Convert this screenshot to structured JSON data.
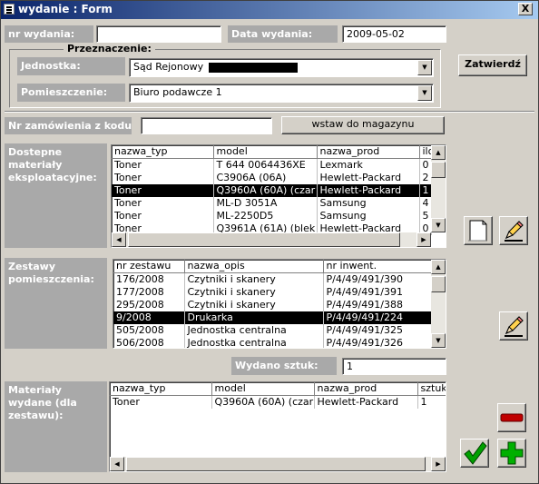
{
  "window": {
    "title": "wydanie : Form",
    "close_label": "X"
  },
  "header": {
    "nr_wydania_label": "nr wydania:",
    "nr_wydania_value": "",
    "data_wydania_label": "Data wydania:",
    "data_wydania_value": "2009-05-02"
  },
  "przeznaczenie": {
    "legend": "Przeznaczenie:",
    "jednostka_label": "Jednostka:",
    "jednostka_value": "Sąd Rejonowy",
    "pomieszczenie_label": "Pomieszczenie:",
    "pomieszczenie_value": "Biuro podawcze 1",
    "confirm_label": "Zatwierdź"
  },
  "order": {
    "label": "Nr zamówienia z kodu:",
    "value": "",
    "insert_label": "wstaw do magazynu"
  },
  "materials": {
    "label": "Dostepne materiały eksploatacyjne:",
    "columns": [
      "nazwa_typ",
      "model",
      "nazwa_prod",
      "ilo"
    ],
    "rows": [
      [
        "Toner",
        "T 644 0064436XE",
        "Lexmark",
        "0"
      ],
      [
        "Toner",
        "C3906A (06A)",
        "Hewlett-Packard",
        "2"
      ],
      [
        "Toner",
        "Q3960A (60A) (czar",
        "Hewlett-Packard",
        "1"
      ],
      [
        "Toner",
        "ML-D 3051A",
        "Samsung",
        "4"
      ],
      [
        "Toner",
        "ML-2250D5",
        "Samsung",
        "5"
      ],
      [
        "Toner",
        "Q3961A (61A) (blek",
        "Hewlett-Packard",
        "0"
      ]
    ],
    "selected_row": 2
  },
  "sets": {
    "label": "Zestawy pomieszczenia:",
    "columns": [
      "nr zestawu",
      "nazwa_opis",
      "nr inwent."
    ],
    "rows": [
      [
        "176/2008",
        "Czytniki i skanery",
        "P/4/49/491/390"
      ],
      [
        "177/2008",
        "Czytniki i skanery",
        "P/4/49/491/391"
      ],
      [
        "295/2008",
        "Czytniki i skanery",
        "P/4/49/491/388"
      ],
      [
        "9/2008",
        "Drukarka",
        "P/4/49/491/224"
      ],
      [
        "505/2008",
        "Jednostka centralna",
        "P/4/49/491/325"
      ],
      [
        "506/2008",
        "Jednostka centralna",
        "P/4/49/491/326"
      ]
    ],
    "selected_row": 3
  },
  "issued": {
    "count_label": "Wydano sztuk:",
    "count_value": "1",
    "label": "Materiały wydane (dla zestawu):",
    "columns": [
      "nazwa_typ",
      "model",
      "nazwa_prod",
      "sztuk"
    ],
    "rows": [
      [
        "Toner",
        "Q3960A (60A) (czar",
        "Hewlett-Packard",
        "1"
      ]
    ]
  },
  "icons": {
    "new_record": "new-document-icon",
    "edit_material": "pencil-icon",
    "edit_set": "pencil-icon",
    "remove": "minus-icon",
    "accept": "checkmark-icon",
    "add": "plus-icon"
  },
  "colors": {
    "title_start": "#0a246a",
    "title_end": "#a6caf0",
    "label_bg": "#a9a9a9",
    "form_bg": "#d4d0c8",
    "minus": "#c00000",
    "plus": "#00a000",
    "check": "#008000"
  }
}
